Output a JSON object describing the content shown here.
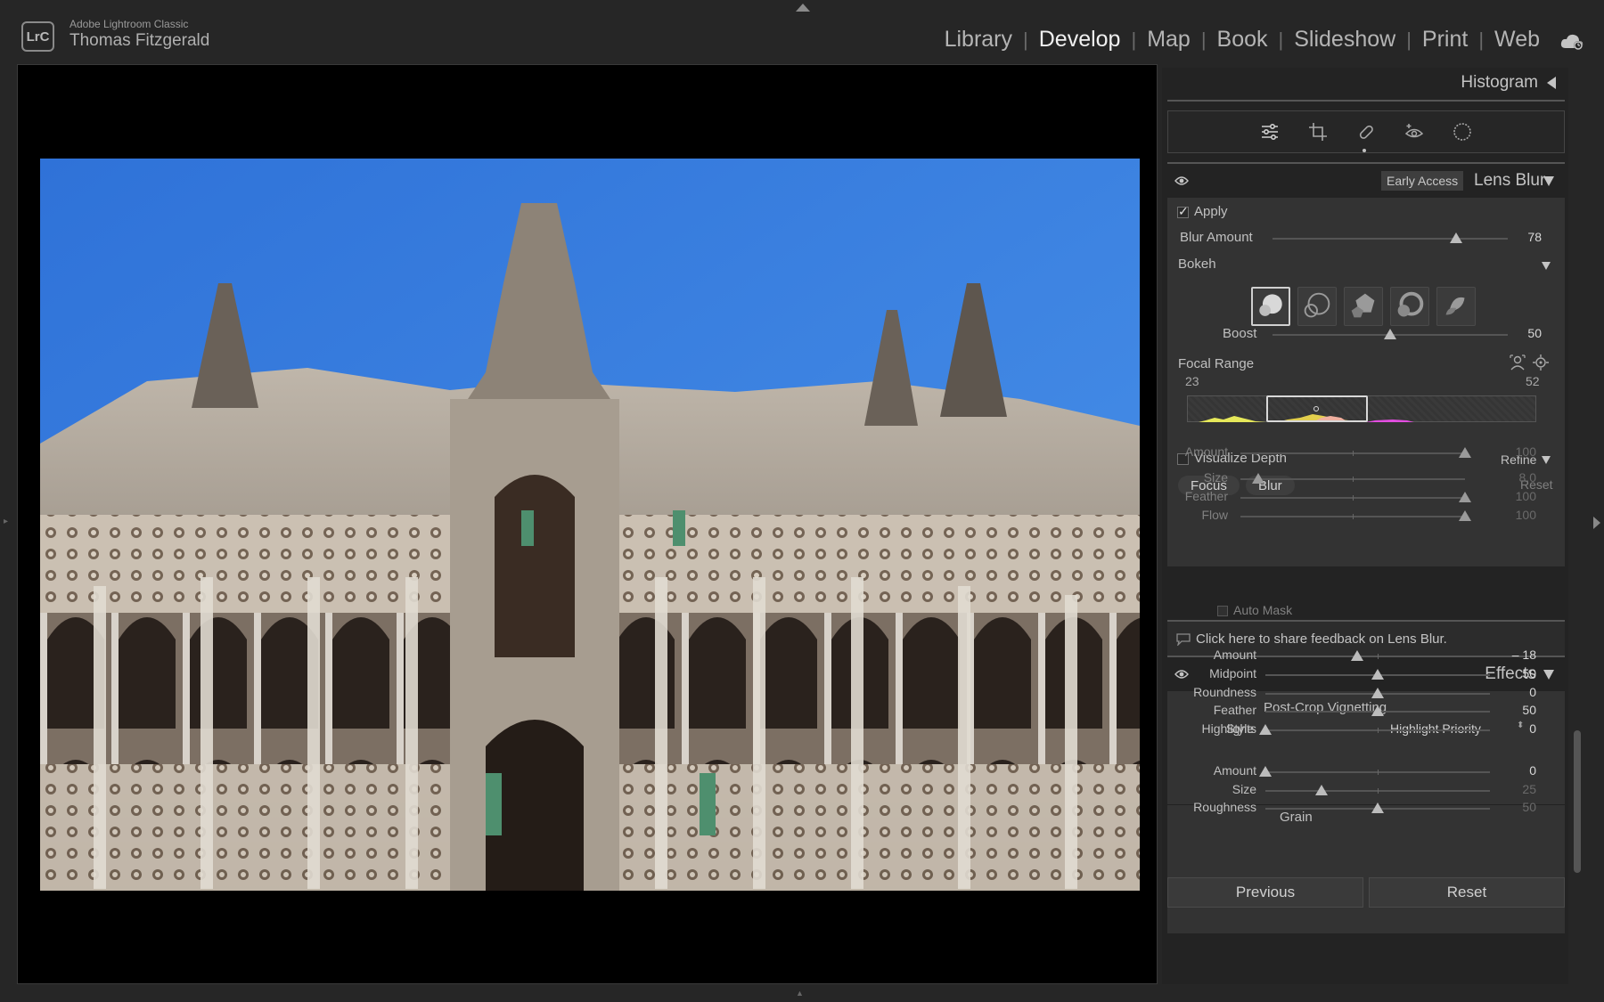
{
  "app": {
    "logo": "LrC",
    "name": "Adobe Lightroom Classic",
    "user": "Thomas Fitzgerald"
  },
  "modules": [
    {
      "label": "Library",
      "active": false
    },
    {
      "label": "Develop",
      "active": true
    },
    {
      "label": "Map",
      "active": false
    },
    {
      "label": "Book",
      "active": false
    },
    {
      "label": "Slideshow",
      "active": false
    },
    {
      "label": "Print",
      "active": false
    },
    {
      "label": "Web",
      "active": false
    }
  ],
  "histogram": {
    "title": "Histogram"
  },
  "lens_blur": {
    "badge": "Early Access",
    "title": "Lens Blur",
    "apply_label": "Apply",
    "apply_checked": true,
    "blur_amount": {
      "label": "Blur Amount",
      "value": "78",
      "fraction": 0.78
    },
    "bokeh_label": "Bokeh",
    "boost": {
      "label": "Boost",
      "value": "50",
      "fraction": 0.5
    },
    "focal_range": {
      "label": "Focal Range",
      "min": "23",
      "max": "52"
    },
    "visualize_depth": "Visualize Depth",
    "refine": "Refine",
    "focus_btn": "Focus",
    "blur_btn": "Blur",
    "reset": "Reset",
    "refine_sliders": [
      {
        "label": "Amount",
        "value": "100",
        "fraction": 1.0
      },
      {
        "label": "Size",
        "value": "8.0",
        "fraction": 0.08
      },
      {
        "label": "Feather",
        "value": "100",
        "fraction": 1.0
      },
      {
        "label": "Flow",
        "value": "100",
        "fraction": 1.0
      }
    ],
    "auto_mask": "Auto Mask",
    "feedback": "Click here to share feedback on Lens Blur."
  },
  "effects": {
    "title": "Effects",
    "vignette_title": "Post-Crop Vignetting",
    "style_label": "Style",
    "style_value": "Highlight Priority",
    "vignette_sliders": [
      {
        "label": "Amount",
        "value": "– 18",
        "fraction": 0.41
      },
      {
        "label": "Midpoint",
        "value": "50",
        "fraction": 0.5
      },
      {
        "label": "Roundness",
        "value": "0",
        "fraction": 0.5
      },
      {
        "label": "Feather",
        "value": "50",
        "fraction": 0.5
      },
      {
        "label": "Highlights",
        "value": "0",
        "fraction": 0.0
      }
    ],
    "grain_title": "Grain",
    "grain_sliders": [
      {
        "label": "Amount",
        "value": "0",
        "fraction": 0.0,
        "dim": false
      },
      {
        "label": "Size",
        "value": "25",
        "fraction": 0.25,
        "dim": true
      },
      {
        "label": "Roughness",
        "value": "50",
        "fraction": 0.5,
        "dim": true
      }
    ]
  },
  "bottom": {
    "previous": "Previous",
    "reset": "Reset"
  }
}
